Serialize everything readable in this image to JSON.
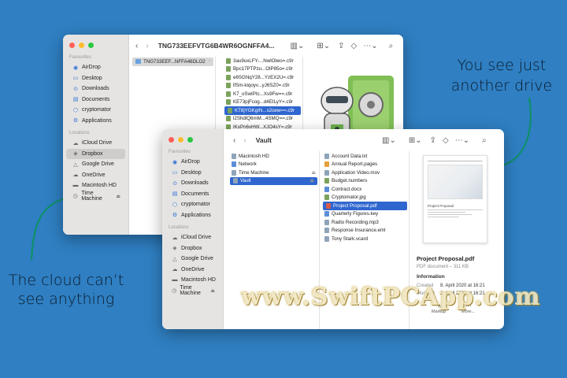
{
  "captions": {
    "right_line1": "You see just",
    "right_line2": "another drive",
    "left_line1": "The cloud can’t",
    "left_line2": "see anything"
  },
  "back_window": {
    "title": "TNG733EEFVTG6B4WR6OGNFFA4...",
    "sidebar": {
      "favourites_head": "Favourites",
      "favourites": [
        {
          "label": "AirDrop",
          "icon": "airdrop-icon"
        },
        {
          "label": "Desktop",
          "icon": "desktop-icon"
        },
        {
          "label": "Downloads",
          "icon": "downloads-icon"
        },
        {
          "label": "Documents",
          "icon": "documents-icon"
        },
        {
          "label": "cryptomator",
          "icon": "cryptomator-icon"
        },
        {
          "label": "Applications",
          "icon": "applications-icon"
        }
      ],
      "locations_head": "Locations",
      "locations": [
        {
          "label": "iCloud Drive",
          "icon": "icloud-icon"
        },
        {
          "label": "Dropbox",
          "icon": "dropbox-icon"
        },
        {
          "label": "Google Drive",
          "icon": "google-drive-icon"
        },
        {
          "label": "OneDrive",
          "icon": "onedrive-icon"
        },
        {
          "label": "Macintosh HD",
          "icon": "disk-icon"
        },
        {
          "label": "Time Machine",
          "icon": "time-machine-icon"
        }
      ]
    },
    "column1": [
      "TNG733EEF...NFFA46DLO2"
    ],
    "column2": [
      "3au9uxLFY-...NwlOlwo=.c9r",
      "Bpc17PTPzu...OlP85o=.c9r",
      "e6SGNqY28...YzEX2U=.c9r",
      "lfSm-kiqoyv...yJ6SZ0=.c9r",
      "K7_oSwIPtc...Xs9Fw==.c9r",
      "KE73pjFcog...d4EILyY=.c9r",
      "KT8jYGKgIN...s2oew==.c9r",
      "l2ShdlQ6mM...4SMQ==.c9r",
      "IKxPn6vHW...XJO4sY=.c9r"
    ]
  },
  "front_window": {
    "title": "Vault",
    "sidebar": {
      "favourites_head": "Favourites",
      "favourites": [
        {
          "label": "AirDrop"
        },
        {
          "label": "Desktop"
        },
        {
          "label": "Downloads"
        },
        {
          "label": "Documents"
        },
        {
          "label": "cryptomator"
        },
        {
          "label": "Applications"
        }
      ],
      "locations_head": "Locations",
      "locations": [
        {
          "label": "iCloud Drive"
        },
        {
          "label": "Dropbox"
        },
        {
          "label": "Google Drive"
        },
        {
          "label": "OneDrive"
        },
        {
          "label": "Macintosh HD"
        },
        {
          "label": "Time Machine"
        }
      ]
    },
    "column1": [
      "Macintosh HD",
      "Network",
      "Time Machine",
      "Vault"
    ],
    "column2": [
      "Account Data.txt",
      "Annual Report.pages",
      "Application Video.mov",
      "Budget.numbers",
      "Contract.docx",
      "Cryptomator.jpg",
      "Project Proposal.pdf",
      "Quarterly Figures.key",
      "Radio Recording.mp3",
      "Response Insurance.eml",
      "Tony Stark.vcard"
    ],
    "preview": {
      "doc_heading": "Project Proposal",
      "file_name": "Project Proposal.pdf",
      "file_meta": "PDF document – 311 KB",
      "info_head": "Information",
      "created_label": "Created",
      "created_value": "8. April 2020 at 16:21",
      "modified_label": "Modified",
      "modified_value": "8. April 2020 at 16:21",
      "markup_label": "Markup",
      "more_label": "More..."
    }
  },
  "watermark": "www.SwiftPCApp.com",
  "colors": {
    "background": "#2f7fc2",
    "selection": "#2f66cf",
    "vault_green": "#6ab04c"
  }
}
